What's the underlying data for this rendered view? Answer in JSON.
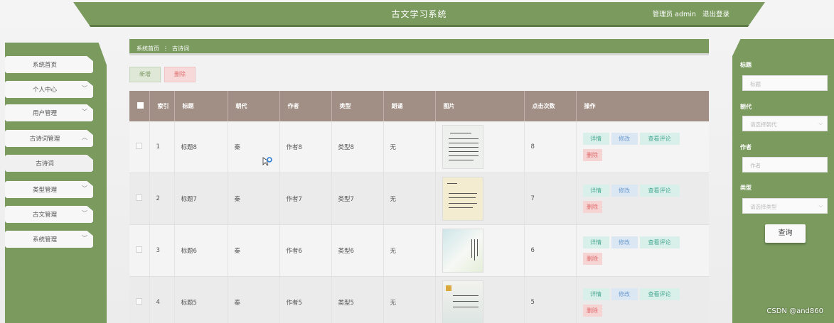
{
  "header": {
    "title": "古文学习系统",
    "user_label": "管理员 admin",
    "logout_label": "退出登录"
  },
  "sidebar": {
    "items": [
      {
        "label": "系统首页",
        "chevron": ""
      },
      {
        "label": "个人中心",
        "chevron": "﹀"
      },
      {
        "label": "用户管理",
        "chevron": "﹀"
      },
      {
        "label": "古诗词管理",
        "chevron": "︿"
      },
      {
        "label": "古诗词",
        "chevron": ""
      },
      {
        "label": "类型管理",
        "chevron": "﹀"
      },
      {
        "label": "古文管理",
        "chevron": "﹀"
      },
      {
        "label": "系统管理",
        "chevron": "﹀"
      }
    ]
  },
  "breadcrumb": {
    "home": "系统首页",
    "separator": "⋮",
    "current": "古诗词"
  },
  "toolbar": {
    "add_label": "新增",
    "delete_label": "删除"
  },
  "table": {
    "headers": [
      "",
      "索引",
      "标题",
      "朝代",
      "作者",
      "类型",
      "朗诵",
      "图片",
      "点击次数",
      "操作"
    ],
    "rows": [
      {
        "index": "1",
        "title": "标题8",
        "dynasty": "秦",
        "author": "作者8",
        "type": "类型8",
        "recite": "无",
        "clicks": "8"
      },
      {
        "index": "2",
        "title": "标题7",
        "dynasty": "秦",
        "author": "作者7",
        "type": "类型7",
        "recite": "无",
        "clicks": "7"
      },
      {
        "index": "3",
        "title": "标题6",
        "dynasty": "秦",
        "author": "作者6",
        "type": "类型6",
        "recite": "无",
        "clicks": "6"
      },
      {
        "index": "4",
        "title": "标题5",
        "dynasty": "秦",
        "author": "作者5",
        "type": "类型5",
        "recite": "无",
        "clicks": "5"
      }
    ],
    "actions": {
      "detail": "详情",
      "edit": "修改",
      "comment": "查看评论",
      "remove": "删除"
    }
  },
  "filter": {
    "title_label": "标题",
    "title_placeholder": "标题",
    "dynasty_label": "朝代",
    "dynasty_placeholder": "请选择朝代",
    "author_label": "作者",
    "author_placeholder": "作者",
    "type_label": "类型",
    "type_placeholder": "请选择类型",
    "search_label": "查询"
  },
  "watermark": "CSDN @and860",
  "colors": {
    "primary": "#7a9a5e",
    "table_header": "#a18f85",
    "danger": "#e06b6b",
    "info": "#48a893"
  }
}
